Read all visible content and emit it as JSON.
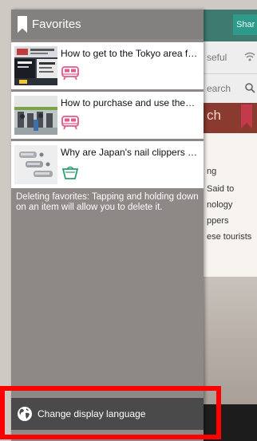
{
  "background": {
    "share_label": "Shar",
    "row1_text": "seful",
    "row2_text": "earch",
    "banner_text": "ch",
    "article_lines": [
      "ng",
      "Said to",
      "nology",
      "ppers",
      "ese tourists"
    ]
  },
  "drawer": {
    "header": {
      "title": "Favorites",
      "icon": "bookmark-icon"
    },
    "favorites": [
      {
        "title": "How to get to the Tokyo area f…",
        "category_icon": "train-icon",
        "category_color": "#e05a8f",
        "thumb": "airport-sign-photo"
      },
      {
        "title": "How to purchase and use the…",
        "category_icon": "train-icon",
        "category_color": "#e05a8f",
        "thumb": "ticket-gate-photo"
      },
      {
        "title": "Why are Japan's nail clippers o…",
        "category_icon": "shopping-bag-icon",
        "category_color": "#2e9e72",
        "thumb": "nail-clippers-photo"
      }
    ],
    "help_text": "Deleting favorites: Tapping and holding down on an item will allow you to delete it.",
    "language_button": {
      "label": "Change display language",
      "icon": "globe-icon"
    }
  },
  "colors": {
    "drawer_bg": "#8e8886",
    "header_bg": "#838080",
    "language_bar_bg": "#4a4a4a",
    "highlight": "#ff0000"
  }
}
